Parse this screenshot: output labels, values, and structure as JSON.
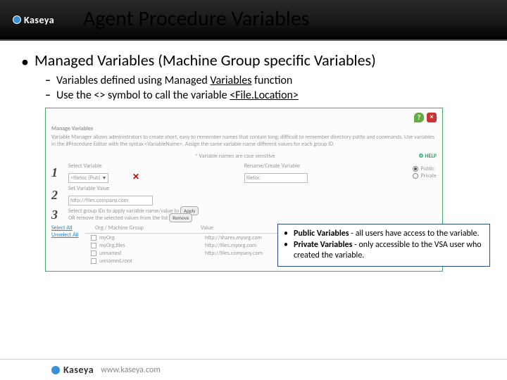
{
  "brand": "Kaseya",
  "title": "Agent Procedure Variables",
  "main_bullet": "Managed Variables (Machine Group specific Variables)",
  "sub_bullets": [
    "Variables defined using Managed ",
    "Use the <> symbol to call the variable "
  ],
  "sub_underlines": [
    "Variables",
    "<File.Location>"
  ],
  "sub_tail": [
    " function",
    ""
  ],
  "panel": {
    "manage_label": "Manage Variables",
    "intro": "Variable Manager allows administrators to create short, easy to remember names that contain long, difficult to remember directory paths and commands. Use variables in the #Procedure Editor with the syntax <VariableName>. Assign the same variable name different values for each group ID.",
    "note": "* Variable names are case sensitive",
    "help": "HELP",
    "step1_label": "Select Variable",
    "step1_value": "<fileloc (Pub)",
    "step1_rename_label": "Rename/Create Variable",
    "step1_rename_value": "fileloc",
    "radio_public": "Public",
    "radio_private": "Private",
    "step2_label": "Set Variable Value",
    "step2_value": "http://files.company.com",
    "step3_label": "Select group IDs to apply variable name/value to",
    "step3_apply": "Apply",
    "step3_or": "OR remove the selected values from the list",
    "step3_remove": "Remove",
    "select_all": "Select All",
    "unselect_all": "Unselect All",
    "col_org": "Org / Machine Group",
    "col_value": "Value",
    "rows": [
      {
        "org": "myOrg",
        "value": "http://shares.myorg.com"
      },
      {
        "org": "myOrg.files",
        "value": "http://files.myorg.com"
      },
      {
        "org": "unnamed",
        "value": "http://files.company.com"
      },
      {
        "org": "unnamed.root",
        "value": ""
      }
    ]
  },
  "callout": {
    "item1_bold": "Public Variables",
    "item1_rest": " - all users have access to the variable.",
    "item2_bold": "Private Variables",
    "item2_rest": " - only accessible to the VSA user who created the variable."
  },
  "footer_url": "www.kaseya.com"
}
